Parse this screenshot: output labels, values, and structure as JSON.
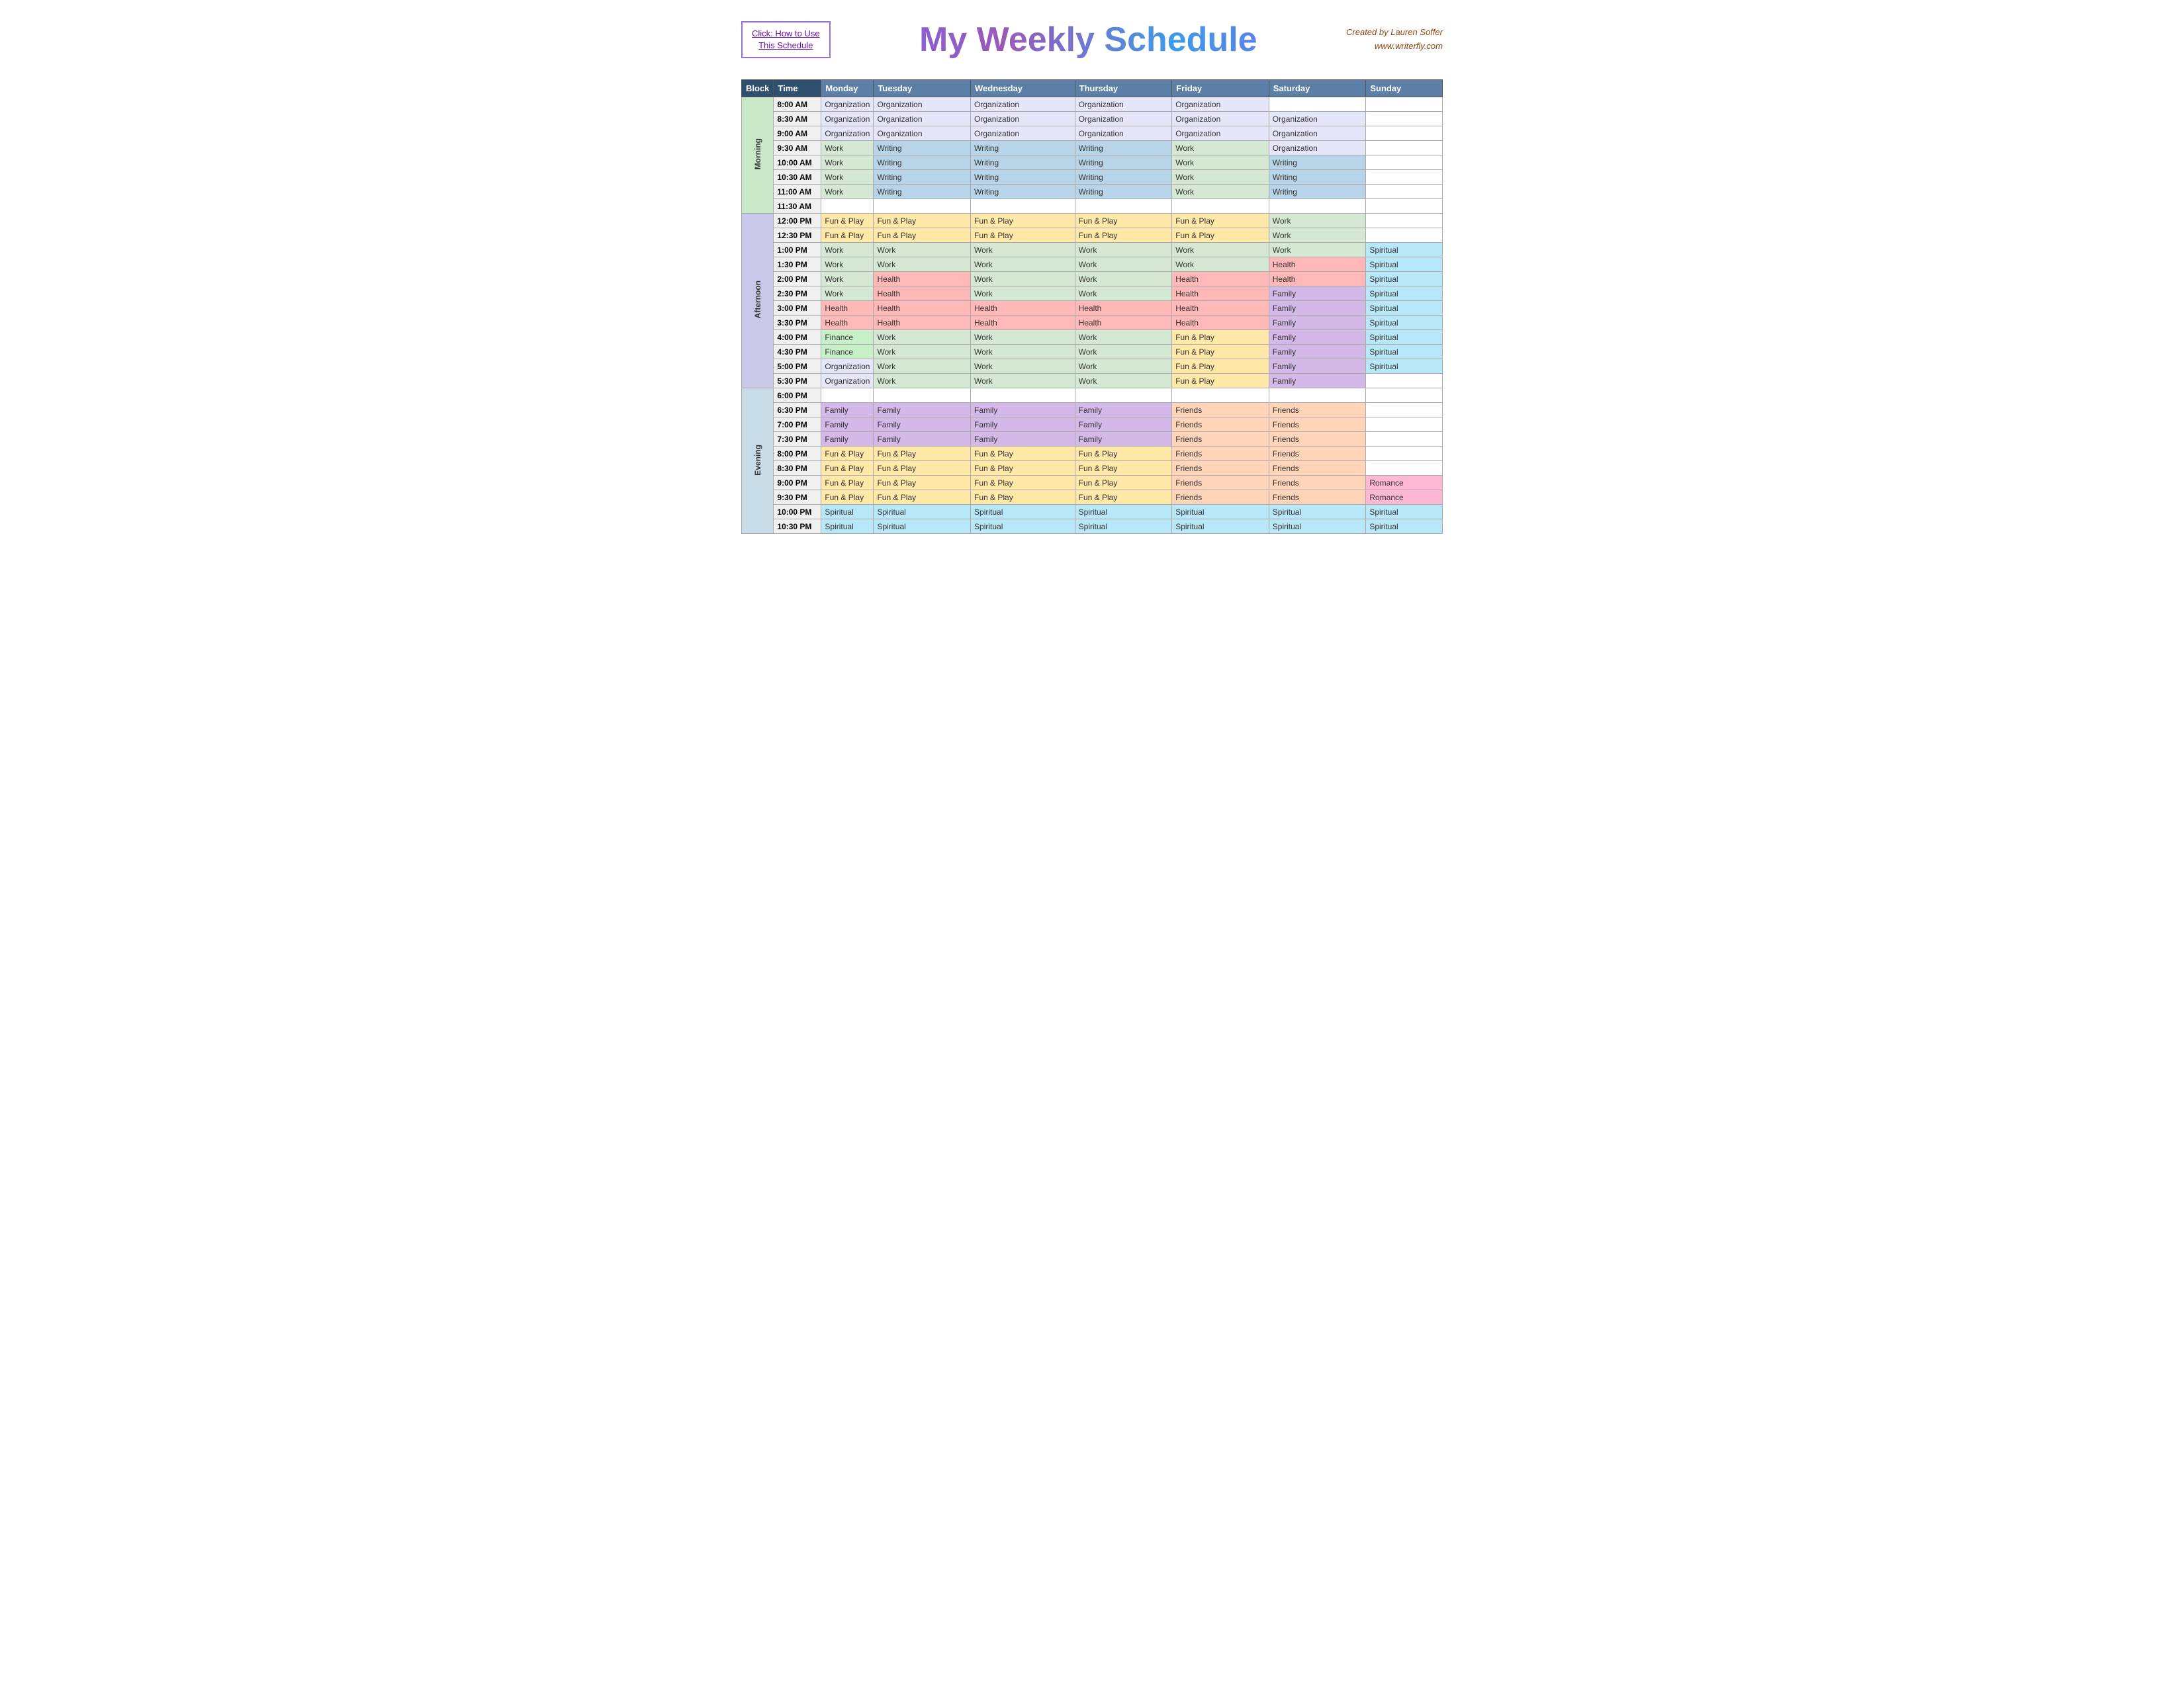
{
  "header": {
    "how_to_use_line1": "Click:  How to Use",
    "how_to_use_line2": "This Schedule",
    "title": "My Weekly Schedule",
    "author_line1": "Created by Lauren Soffer",
    "author_line2": "www.writerfly.com"
  },
  "table": {
    "headers": {
      "block": "Block",
      "time": "Time",
      "monday": "Monday",
      "tuesday": "Tuesday",
      "wednesday": "Wednesday",
      "thursday": "Thursday",
      "friday": "Friday",
      "saturday": "Saturday",
      "sunday": "Sunday"
    },
    "blocks": {
      "morning": "Morning",
      "afternoon": "Afternoon",
      "evening": "Evening"
    },
    "rows": [
      {
        "time": "8:00 AM",
        "block": "Morning",
        "mon": "Organization",
        "tue": "Organization",
        "wed": "Organization",
        "thu": "Organization",
        "fri": "Organization",
        "sat": "",
        "sun": ""
      },
      {
        "time": "8:30 AM",
        "block": "Morning",
        "mon": "Organization",
        "tue": "Organization",
        "wed": "Organization",
        "thu": "Organization",
        "fri": "Organization",
        "sat": "Organization",
        "sun": ""
      },
      {
        "time": "9:00 AM",
        "block": "Morning",
        "mon": "Organization",
        "tue": "Organization",
        "wed": "Organization",
        "thu": "Organization",
        "fri": "Organization",
        "sat": "Organization",
        "sun": ""
      },
      {
        "time": "9:30 AM",
        "block": "Morning",
        "mon": "Work",
        "tue": "Writing",
        "wed": "Writing",
        "thu": "Writing",
        "fri": "Work",
        "sat": "Organization",
        "sun": ""
      },
      {
        "time": "10:00 AM",
        "block": "Morning",
        "mon": "Work",
        "tue": "Writing",
        "wed": "Writing",
        "thu": "Writing",
        "fri": "Work",
        "sat": "Writing",
        "sun": ""
      },
      {
        "time": "10:30 AM",
        "block": "Morning",
        "mon": "Work",
        "tue": "Writing",
        "wed": "Writing",
        "thu": "Writing",
        "fri": "Work",
        "sat": "Writing",
        "sun": ""
      },
      {
        "time": "11:00 AM",
        "block": "Morning",
        "mon": "Work",
        "tue": "Writing",
        "wed": "Writing",
        "thu": "Writing",
        "fri": "Work",
        "sat": "Writing",
        "sun": ""
      },
      {
        "time": "11:30 AM",
        "block": "Morning",
        "mon": "",
        "tue": "",
        "wed": "",
        "thu": "",
        "fri": "",
        "sat": "",
        "sun": ""
      },
      {
        "time": "12:00 PM",
        "block": "Afternoon",
        "mon": "Fun & Play",
        "tue": "Fun & Play",
        "wed": "Fun & Play",
        "thu": "Fun & Play",
        "fri": "Fun & Play",
        "sat": "Work",
        "sun": ""
      },
      {
        "time": "12:30 PM",
        "block": "Afternoon",
        "mon": "Fun & Play",
        "tue": "Fun & Play",
        "wed": "Fun & Play",
        "thu": "Fun & Play",
        "fri": "Fun & Play",
        "sat": "Work",
        "sun": ""
      },
      {
        "time": "1:00 PM",
        "block": "Afternoon",
        "mon": "Work",
        "tue": "Work",
        "wed": "Work",
        "thu": "Work",
        "fri": "Work",
        "sat": "Work",
        "sun": "Spiritual"
      },
      {
        "time": "1:30 PM",
        "block": "Afternoon",
        "mon": "Work",
        "tue": "Work",
        "wed": "Work",
        "thu": "Work",
        "fri": "Work",
        "sat": "Health",
        "sun": "Spiritual"
      },
      {
        "time": "2:00 PM",
        "block": "Afternoon",
        "mon": "Work",
        "tue": "Health",
        "wed": "Work",
        "thu": "Work",
        "fri": "Health",
        "sat": "Health",
        "sun": "Spiritual"
      },
      {
        "time": "2:30 PM",
        "block": "Afternoon",
        "mon": "Work",
        "tue": "Health",
        "wed": "Work",
        "thu": "Work",
        "fri": "Health",
        "sat": "Family",
        "sun": "Spiritual"
      },
      {
        "time": "3:00 PM",
        "block": "Afternoon",
        "mon": "Health",
        "tue": "Health",
        "wed": "Health",
        "thu": "Health",
        "fri": "Health",
        "sat": "Family",
        "sun": "Spiritual"
      },
      {
        "time": "3:30 PM",
        "block": "Afternoon",
        "mon": "Health",
        "tue": "Health",
        "wed": "Health",
        "thu": "Health",
        "fri": "Health",
        "sat": "Family",
        "sun": "Spiritual"
      },
      {
        "time": "4:00 PM",
        "block": "Afternoon",
        "mon": "Finance",
        "tue": "Work",
        "wed": "Work",
        "thu": "Work",
        "fri": "Fun & Play",
        "sat": "Family",
        "sun": "Spiritual"
      },
      {
        "time": "4:30 PM",
        "block": "Afternoon",
        "mon": "Finance",
        "tue": "Work",
        "wed": "Work",
        "thu": "Work",
        "fri": "Fun & Play",
        "sat": "Family",
        "sun": "Spiritual"
      },
      {
        "time": "5:00 PM",
        "block": "Afternoon",
        "mon": "Organization",
        "tue": "Work",
        "wed": "Work",
        "thu": "Work",
        "fri": "Fun & Play",
        "sat": "Family",
        "sun": "Spiritual"
      },
      {
        "time": "5:30 PM",
        "block": "Afternoon",
        "mon": "Organization",
        "tue": "Work",
        "wed": "Work",
        "thu": "Work",
        "fri": "Fun & Play",
        "sat": "Family",
        "sun": ""
      },
      {
        "time": "6:00 PM",
        "block": "Evening",
        "mon": "",
        "tue": "",
        "wed": "",
        "thu": "",
        "fri": "",
        "sat": "",
        "sun": ""
      },
      {
        "time": "6:30 PM",
        "block": "Evening",
        "mon": "Family",
        "tue": "Family",
        "wed": "Family",
        "thu": "Family",
        "fri": "Friends",
        "sat": "Friends",
        "sun": ""
      },
      {
        "time": "7:00 PM",
        "block": "Evening",
        "mon": "Family",
        "tue": "Family",
        "wed": "Family",
        "thu": "Family",
        "fri": "Friends",
        "sat": "Friends",
        "sun": ""
      },
      {
        "time": "7:30 PM",
        "block": "Evening",
        "mon": "Family",
        "tue": "Family",
        "wed": "Family",
        "thu": "Family",
        "fri": "Friends",
        "sat": "Friends",
        "sun": ""
      },
      {
        "time": "8:00 PM",
        "block": "Evening",
        "mon": "Fun & Play",
        "tue": "Fun & Play",
        "wed": "Fun & Play",
        "thu": "Fun & Play",
        "fri": "Friends",
        "sat": "Friends",
        "sun": ""
      },
      {
        "time": "8:30 PM",
        "block": "Evening",
        "mon": "Fun & Play",
        "tue": "Fun & Play",
        "wed": "Fun & Play",
        "thu": "Fun & Play",
        "fri": "Friends",
        "sat": "Friends",
        "sun": ""
      },
      {
        "time": "9:00 PM",
        "block": "Evening",
        "mon": "Fun & Play",
        "tue": "Fun & Play",
        "wed": "Fun & Play",
        "thu": "Fun & Play",
        "fri": "Friends",
        "sat": "Friends",
        "sun": "Romance"
      },
      {
        "time": "9:30 PM",
        "block": "Evening",
        "mon": "Fun & Play",
        "tue": "Fun & Play",
        "wed": "Fun & Play",
        "thu": "Fun & Play",
        "fri": "Friends",
        "sat": "Friends",
        "sun": "Romance"
      },
      {
        "time": "10:00 PM",
        "block": "Evening",
        "mon": "Spiritual",
        "tue": "Spiritual",
        "wed": "Spiritual",
        "thu": "Spiritual",
        "fri": "Spiritual",
        "sat": "Spiritual",
        "sun": "Spiritual"
      },
      {
        "time": "10:30 PM",
        "block": "Evening",
        "mon": "Spiritual",
        "tue": "Spiritual",
        "wed": "Spiritual",
        "thu": "Spiritual",
        "fri": "Spiritual",
        "sat": "Spiritual",
        "sun": "Spiritual"
      }
    ]
  }
}
